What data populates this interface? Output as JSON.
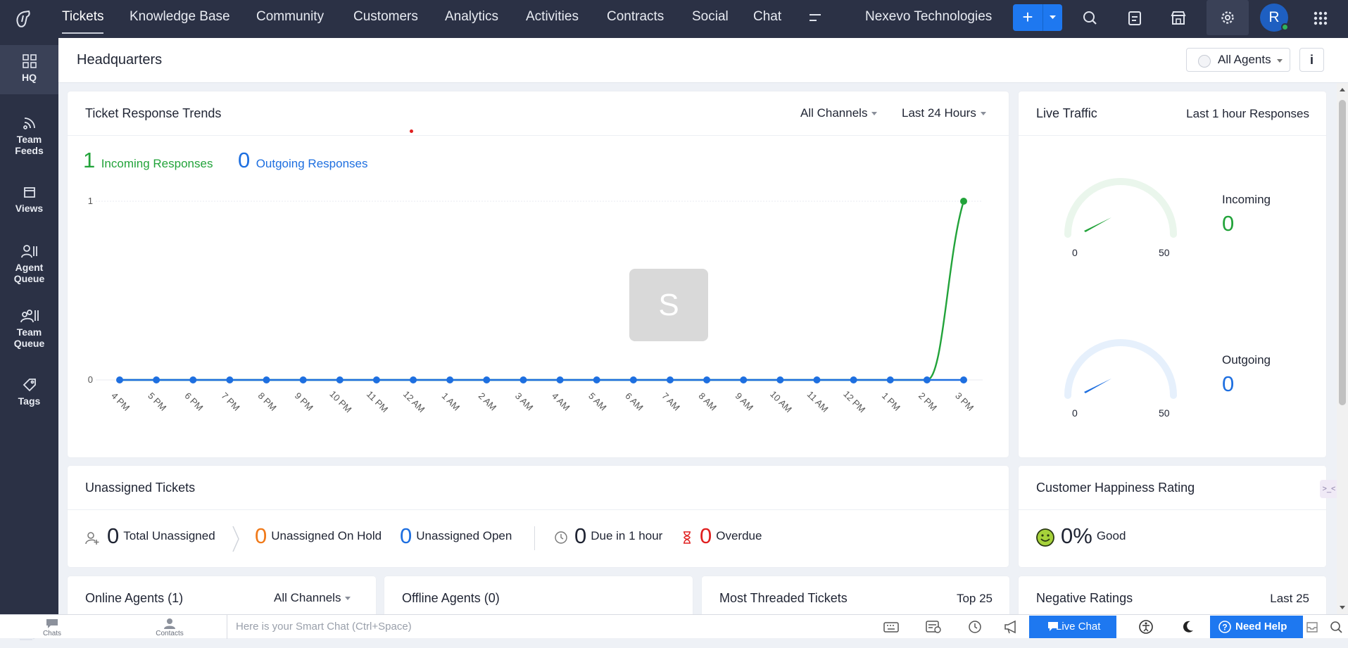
{
  "nav": {
    "tabs": [
      "Tickets",
      "Knowledge Base",
      "Community",
      "Customers",
      "Analytics",
      "Activities",
      "Contracts",
      "Social",
      "Chat"
    ],
    "org": "Nexevo Technologies",
    "avatar_letter": "R"
  },
  "sidebar": {
    "items": [
      {
        "label": "HQ",
        "icon": "grid-icon"
      },
      {
        "label": "Team Feeds",
        "icon": "feed-icon"
      },
      {
        "label": "Views",
        "icon": "views-icon"
      },
      {
        "label": "Agent Queue",
        "icon": "agent-queue-icon"
      },
      {
        "label": "Team Queue",
        "icon": "team-queue-icon"
      },
      {
        "label": "Tags",
        "icon": "tag-icon"
      }
    ]
  },
  "header": {
    "title": "Headquarters",
    "agents_filter": "All Agents",
    "info": "i"
  },
  "trends": {
    "title": "Ticket Response Trends",
    "channel_filter": "All Channels",
    "period_filter": "Last 24 Hours",
    "incoming_count": "1",
    "incoming_label": "Incoming Responses",
    "outgoing_count": "0",
    "outgoing_label": "Outgoing Responses",
    "overlay_letter": "S"
  },
  "chart_data": {
    "type": "line",
    "categories": [
      "4 PM",
      "5 PM",
      "6 PM",
      "7 PM",
      "8 PM",
      "9 PM",
      "10 PM",
      "11 PM",
      "12 AM",
      "1 AM",
      "2 AM",
      "3 AM",
      "4 AM",
      "5 AM",
      "6 AM",
      "7 AM",
      "8 AM",
      "9 AM",
      "10 AM",
      "11 AM",
      "12 PM",
      "1 PM",
      "2 PM",
      "3 PM"
    ],
    "series": [
      {
        "name": "Incoming Responses",
        "color": "#22a33a",
        "values": [
          0,
          0,
          0,
          0,
          0,
          0,
          0,
          0,
          0,
          0,
          0,
          0,
          0,
          0,
          0,
          0,
          0,
          0,
          0,
          0,
          0,
          0,
          0,
          1
        ]
      },
      {
        "name": "Outgoing Responses",
        "color": "#1e6fe0",
        "values": [
          0,
          0,
          0,
          0,
          0,
          0,
          0,
          0,
          0,
          0,
          0,
          0,
          0,
          0,
          0,
          0,
          0,
          0,
          0,
          0,
          0,
          0,
          0,
          0
        ]
      }
    ],
    "y_ticks": [
      "0",
      "1"
    ],
    "ylim": [
      0,
      1
    ]
  },
  "live": {
    "title": "Live Traffic",
    "period": "Last 1 hour Responses",
    "gauges": [
      {
        "label": "Incoming",
        "value": "0",
        "min": "0",
        "max": "50",
        "color": "#22a33a",
        "track": "#eaf6ec"
      },
      {
        "label": "Outgoing",
        "value": "0",
        "min": "0",
        "max": "50",
        "color": "#1e6fe0",
        "track": "#e6f0fc"
      }
    ]
  },
  "unassigned": {
    "title": "Unassigned Tickets",
    "total": {
      "n": "0",
      "label": "Total Unassigned"
    },
    "on_hold": {
      "n": "0",
      "label": "Unassigned On Hold"
    },
    "open": {
      "n": "0",
      "label": "Unassigned Open"
    },
    "due": {
      "n": "0",
      "label": "Due in 1 hour"
    },
    "overdue": {
      "n": "0",
      "label": "Overdue"
    }
  },
  "happiness": {
    "title": "Customer Happiness Rating",
    "value": "0%",
    "label": "Good"
  },
  "online_agents": {
    "title": "Online Agents (1)",
    "filter": "All Channels"
  },
  "offline_agents": {
    "title": "Offline Agents (0)"
  },
  "threaded": {
    "title": "Most Threaded Tickets",
    "right": "Top 25"
  },
  "negative": {
    "title": "Negative Ratings",
    "right": "Last 25"
  },
  "bottom": {
    "chats": "Chats",
    "contacts": "Contacts",
    "smartchat_placeholder": "Here is your Smart Chat (Ctrl+Space)",
    "live_chat": "Live Chat",
    "need_help": "Need Help"
  }
}
